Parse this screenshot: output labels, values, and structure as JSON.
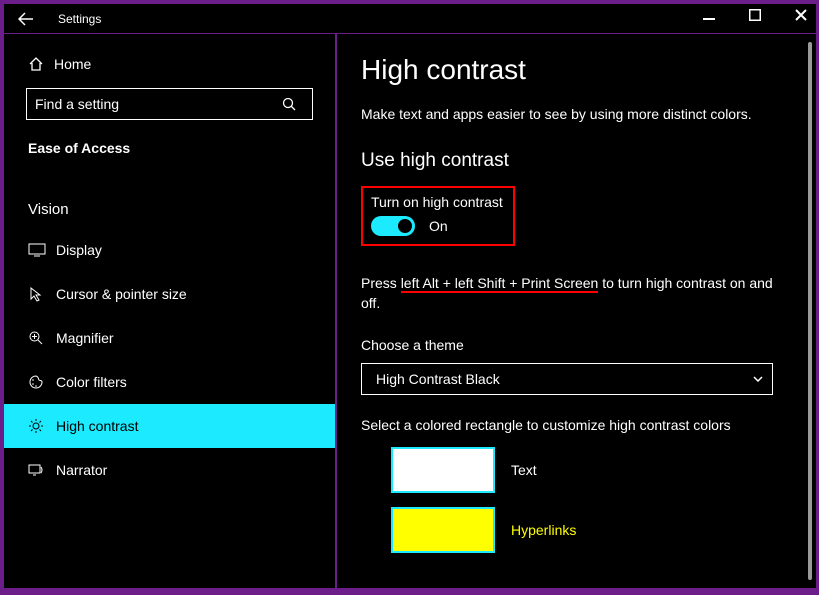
{
  "window": {
    "title": "Settings"
  },
  "sidebar": {
    "home": "Home",
    "search_placeholder": "Find a setting",
    "section": "Ease of Access",
    "group": "Vision",
    "items": [
      {
        "label": "Display"
      },
      {
        "label": "Cursor & pointer size"
      },
      {
        "label": "Magnifier"
      },
      {
        "label": "Color filters"
      },
      {
        "label": "High contrast"
      },
      {
        "label": "Narrator"
      }
    ]
  },
  "main": {
    "title": "High contrast",
    "intro": "Make text and apps easier to see by using more distinct colors.",
    "section_toggle": "Use high contrast",
    "toggle_label": "Turn on high contrast",
    "toggle_state": "On",
    "hotkey_pre": "Press ",
    "hotkey_underlined": "left Alt + left Shift + Print Screen",
    "hotkey_post": " to turn high contrast on and off.",
    "choose_label": "Choose a theme",
    "theme_selected": "High Contrast Black",
    "swatch_intro": "Select a colored rectangle to customize high contrast colors",
    "swatch_text": "Text",
    "swatch_hyper": "Hyperlinks"
  },
  "colors": {
    "accent": "#1cebff",
    "hyperlink": "#ffff00",
    "border": "#6b1e8a"
  }
}
